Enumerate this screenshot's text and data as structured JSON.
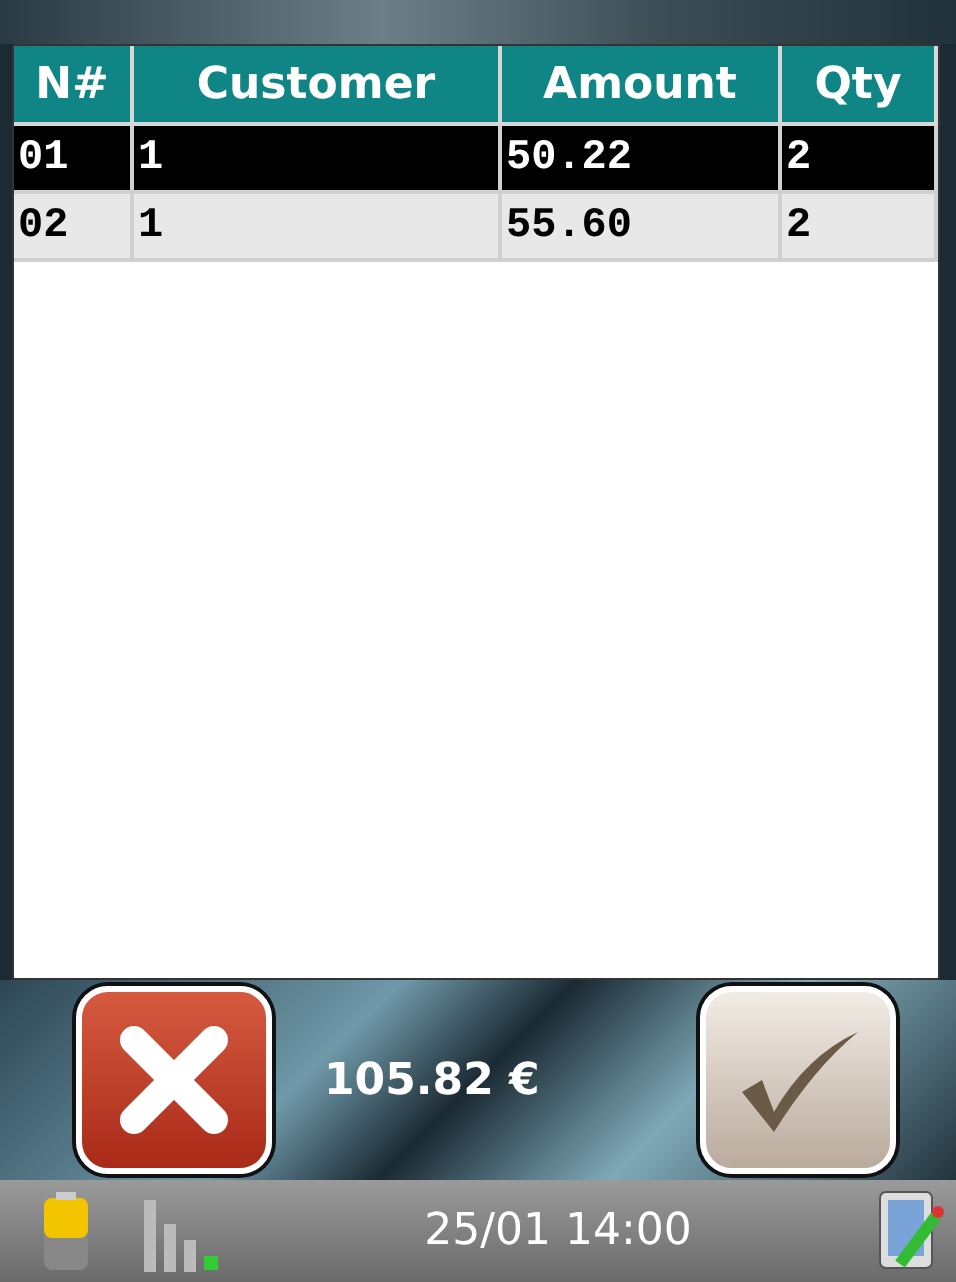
{
  "table": {
    "columns": [
      "N#",
      "Customer",
      "Amount",
      "Qty"
    ],
    "rows": [
      {
        "cells": [
          "01",
          "1",
          "50.22",
          "2"
        ],
        "selected": true
      },
      {
        "cells": [
          "02",
          "1",
          "55.60",
          "2"
        ],
        "selected": false
      }
    ]
  },
  "total": "105.82 €",
  "status_bar": {
    "datetime": "25/01 14:00"
  }
}
